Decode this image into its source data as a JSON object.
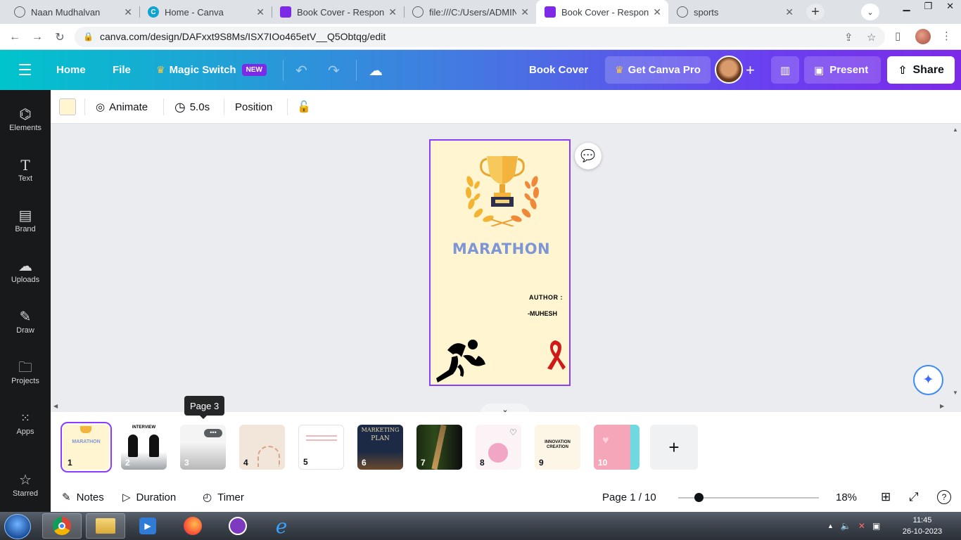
{
  "browser": {
    "tabs": [
      {
        "title": "Naan Mudhalvan",
        "active": false
      },
      {
        "title": "Home - Canva",
        "active": false
      },
      {
        "title": "Book Cover - Responsiv",
        "active": false
      },
      {
        "title": "file:///C:/Users/ADMIN/",
        "active": false
      },
      {
        "title": "Book Cover - Responsiv",
        "active": true
      },
      {
        "title": "sports",
        "active": false
      }
    ],
    "url": "canva.com/design/DAFxxt9S8Ms/ISX7IOo465etV__Q5Obtqg/edit"
  },
  "header": {
    "home": "Home",
    "file": "File",
    "magic_switch": "Magic Switch",
    "new_badge": "NEW",
    "design_title": "Book Cover",
    "get_pro": "Get Canva Pro",
    "present": "Present",
    "share": "Share"
  },
  "rail": [
    {
      "label": "Elements",
      "icon": "elements-icon"
    },
    {
      "label": "Text",
      "icon": "text-icon"
    },
    {
      "label": "Brand",
      "icon": "brand-icon"
    },
    {
      "label": "Uploads",
      "icon": "uploads-icon"
    },
    {
      "label": "Draw",
      "icon": "draw-icon"
    },
    {
      "label": "Projects",
      "icon": "projects-icon"
    },
    {
      "label": "Apps",
      "icon": "apps-icon"
    },
    {
      "label": "Starred",
      "icon": "star-icon"
    }
  ],
  "toolbar": {
    "animate": "Animate",
    "duration": "5.0s",
    "position": "Position",
    "swatch_color": "#fff6d1"
  },
  "design": {
    "title": "MARATHON",
    "author_label": "AUTHOR :",
    "author_name": "-MUHESH",
    "bg_color": "#fff6d1",
    "title_color": "#7e96d6"
  },
  "tooltip": "Page 3",
  "pages": [
    {
      "num": "1",
      "selected": true,
      "title": "MARATHON"
    },
    {
      "num": "2",
      "title": "INTERVIEW"
    },
    {
      "num": "3"
    },
    {
      "num": "4"
    },
    {
      "num": "5"
    },
    {
      "num": "6",
      "l1": "MARKETING",
      "l2": "PLAN"
    },
    {
      "num": "7"
    },
    {
      "num": "8"
    },
    {
      "num": "9",
      "l1": "INNOVATION",
      "l2": "CREATION"
    },
    {
      "num": "10"
    }
  ],
  "footer": {
    "notes": "Notes",
    "duration": "Duration",
    "timer": "Timer",
    "page_indicator": "Page 1 / 10",
    "zoom": "18%",
    "zoom_fraction": 0.15
  },
  "taskbar": {
    "time": "11:45",
    "date": "26-10-2023"
  }
}
